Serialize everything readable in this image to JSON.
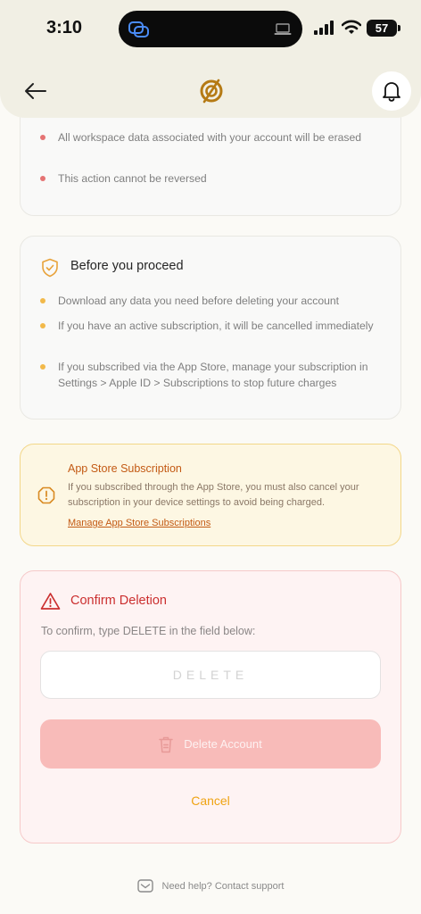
{
  "status": {
    "time": "3:10",
    "battery": "57"
  },
  "header": {
    "back_icon": "arrow-left-icon",
    "logo_icon": "ring-logo-icon",
    "bell_icon": "bell-icon"
  },
  "consequences": {
    "items": [
      "All workspace data associated with your account will be erased",
      "This action cannot be reversed"
    ],
    "dot_color": "#e57373"
  },
  "proceed": {
    "title": "Before you proceed",
    "icon": "shield-check-icon",
    "dot_color": "#f2b94a",
    "items": [
      "Download any data you need before deleting your account",
      "If you have an active subscription, it will be cancelled immediately",
      "If you subscribed via the App Store, manage your subscription in Settings > Apple ID > Subscriptions to stop future charges"
    ]
  },
  "appstore": {
    "title": "App Store Subscription",
    "icon": "alert-octagon-icon",
    "body": "If you subscribed through the App Store, you must also cancel your subscription in your device settings to avoid being charged.",
    "link": "Manage App Store Subscriptions",
    "accent": "#c35a14"
  },
  "confirm": {
    "title": "Confirm Deletion",
    "icon": "warning-triangle-icon",
    "instruction": "To confirm, type DELETE in the field below:",
    "input_value": "",
    "input_placeholder": "DELETE",
    "delete_label": "Delete Account",
    "delete_icon": "trash-icon",
    "cancel_label": "Cancel",
    "accent": "#cb2f2f"
  },
  "footer": {
    "help_text": "Need help? Contact support",
    "help_icon": "mail-icon"
  }
}
